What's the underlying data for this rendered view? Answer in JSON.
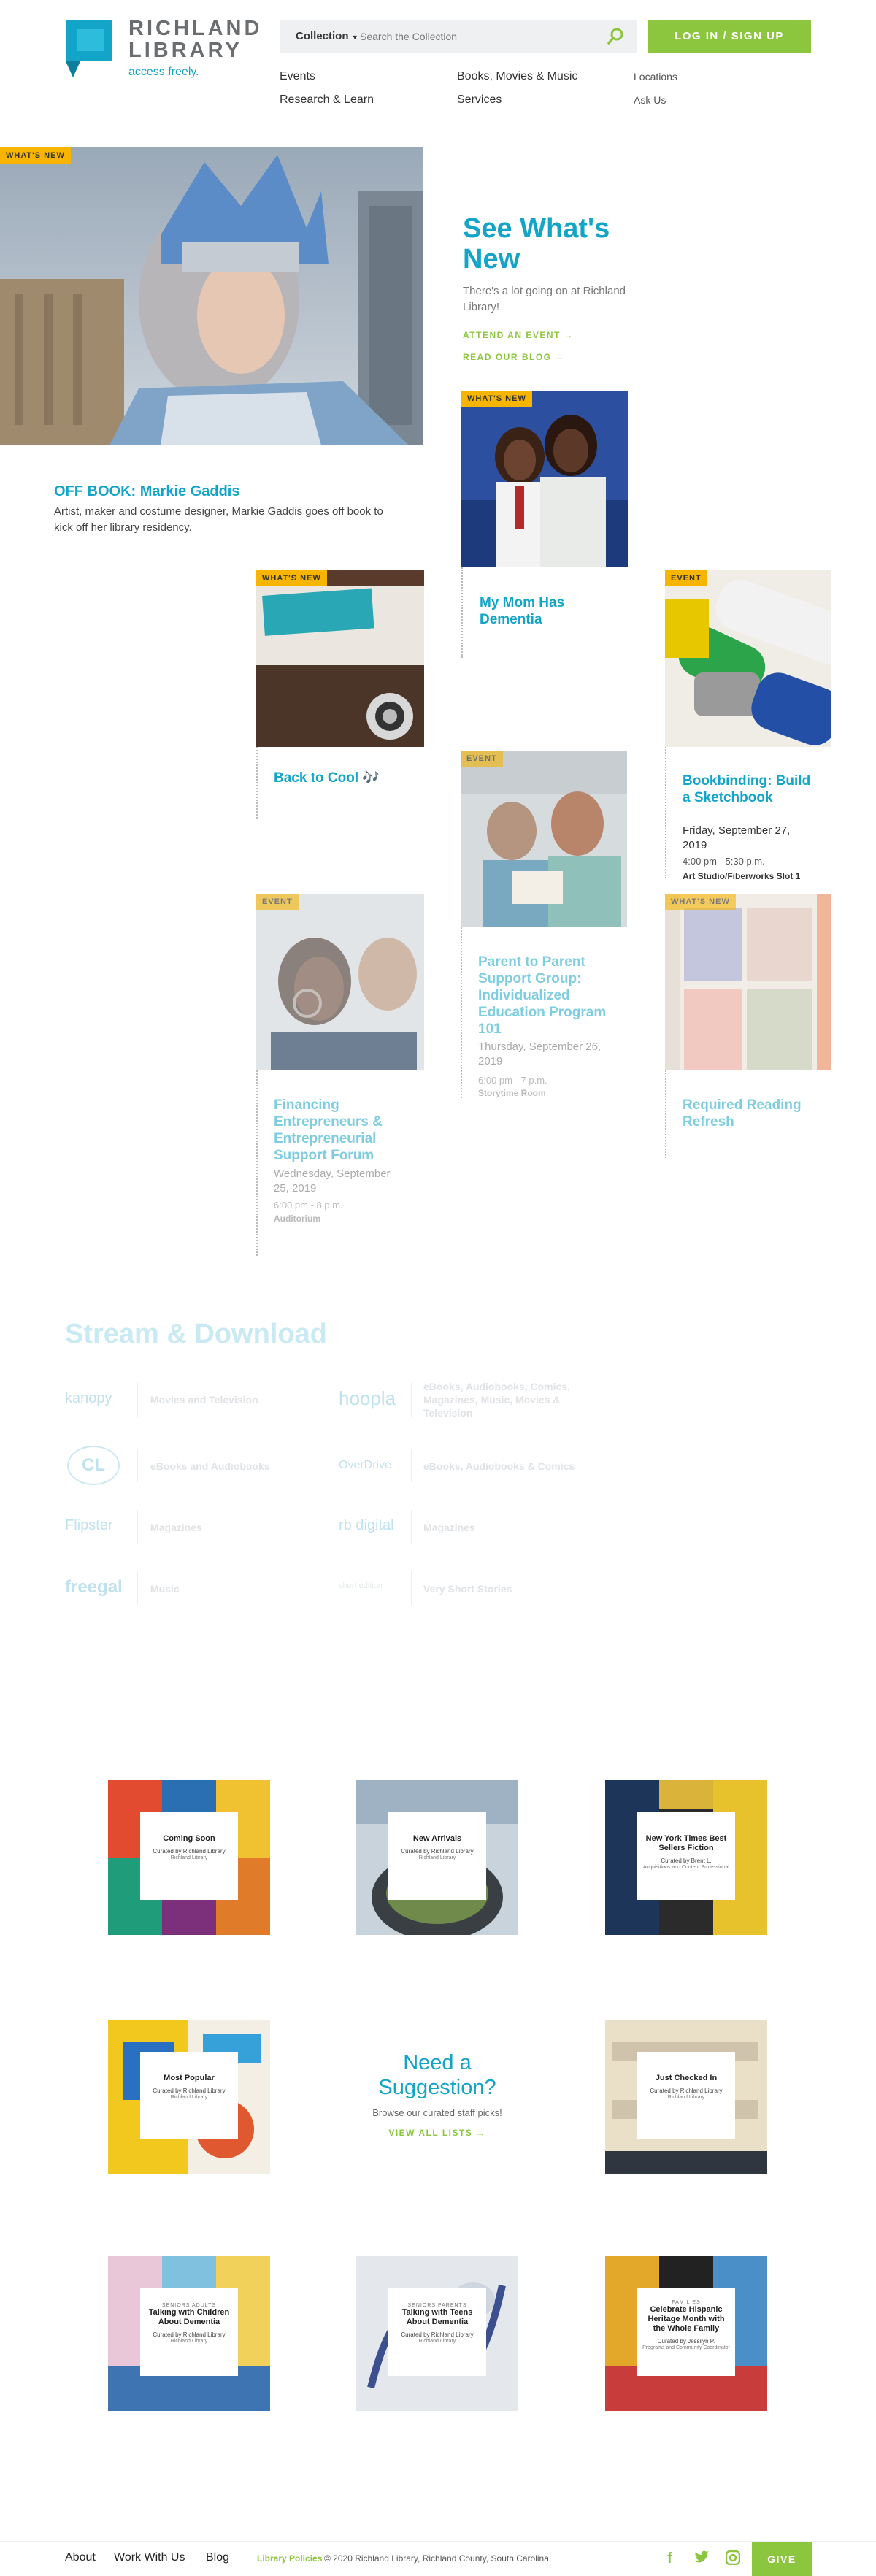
{
  "header": {
    "logo_title_line1": "RICHLAND",
    "logo_title_line2": "LIBRARY",
    "logo_tagline": "access freely.",
    "search_scope": "Collection",
    "search_placeholder": "Search the Collection",
    "login_label": "LOG IN / SIGN UP",
    "nav": [
      "Events",
      "Research & Learn",
      "Books, Movies & Music",
      "Services"
    ],
    "nav_small": [
      "Locations",
      "Ask Us"
    ]
  },
  "feature": {
    "badge": "WHAT'S NEW",
    "title": "OFF BOOK: Markie Gaddis",
    "desc": "Artist, maker and costume designer, Markie Gaddis goes off book to kick off her library residency."
  },
  "intro": {
    "title": "See What's New",
    "desc": "There's a lot going on at Richland Library!",
    "link1": "ATTEND AN EVENT →",
    "link2": "READ OUR BLOG →"
  },
  "cards": [
    {
      "badge": "WHAT'S NEW",
      "title": "My Mom Has Dementia"
    },
    {
      "badge": "WHAT'S NEW",
      "title": "Back to Cool 🎶"
    },
    {
      "badge": "EVENT",
      "title": "Bookbinding: Build a Sketchbook",
      "date": "Friday, September 27, 2019",
      "time": "4:00 pm - 5:30 p.m.",
      "location": "Art Studio/Fiberworks Slot 1"
    },
    {
      "badge": "EVENT",
      "title": "Parent to Parent Support Group: Individualized Education Program 101",
      "date": "Thursday, September 26, 2019",
      "time": "6:00 pm - 7 p.m.",
      "location": "Storytime Room"
    },
    {
      "badge": "EVENT",
      "title": "Financing Entrepreneurs & Entrepreneurial Support Forum",
      "date": "Wednesday, September 25, 2019",
      "time": "6:00 pm - 8 p.m.",
      "location": "Auditorium"
    },
    {
      "badge": "WHAT'S NEW",
      "title": "Required Reading Refresh"
    }
  ],
  "stream": {
    "title": "Stream & Download",
    "items": [
      {
        "logo": "kanopy",
        "desc": "Movies and Television"
      },
      {
        "logo": "hoopla",
        "desc": "eBooks, Audiobooks, Comics, Magazines, Music, Movies & Television"
      },
      {
        "logo": "CL",
        "desc": "eBooks and Audiobooks"
      },
      {
        "logo": "OverDrive",
        "desc": "eBooks, Audiobooks & Comics"
      },
      {
        "logo": "Flipster",
        "desc": "Magazines"
      },
      {
        "logo": "rb digital",
        "desc": "Magazines"
      },
      {
        "logo": "freegal",
        "desc": "Music"
      },
      {
        "logo": "short edition",
        "desc": "Very Short Stories"
      }
    ]
  },
  "lists": [
    {
      "kicker": "",
      "title": "Coming Soon",
      "curator": "Curated by Richland Library",
      "sub": "Richland Library"
    },
    {
      "kicker": "",
      "title": "New Arrivals",
      "curator": "Curated by Richland Library",
      "sub": "Richland Library"
    },
    {
      "kicker": "",
      "title": "New York Times Best Sellers Fiction",
      "curator": "Curated by Brent L.",
      "sub": "Acquisitions and Content Professional"
    },
    {
      "kicker": "",
      "title": "Most Popular",
      "curator": "Curated by Richland Library",
      "sub": "Richland Library"
    },
    {
      "kicker": "",
      "title": "Just Checked In",
      "curator": "Curated by Richland Library",
      "sub": "Richland Library"
    },
    {
      "kicker": "SENIORS ADULTS",
      "title": "Talking with Children About Dementia",
      "curator": "Curated by Richland Library",
      "sub": "Richland Library"
    },
    {
      "kicker": "SENIORS PARENTS",
      "title": "Talking with Teens About Dementia",
      "curator": "Curated by Richland Library",
      "sub": "Richland Library"
    },
    {
      "kicker": "FAMILIES",
      "title": "Celebrate Hispanic Heritage Month with the Whole Family",
      "curator": "Curated by Jessilyn P.",
      "sub": "Programs and Community Coordinator"
    }
  ],
  "suggestion": {
    "title": "Need a Suggestion?",
    "desc": "Browse our curated staff picks!",
    "link": "VIEW ALL LISTS →"
  },
  "footer": {
    "links": [
      "About",
      "Work With Us",
      "Blog"
    ],
    "policies": "Library Policies",
    "copyright": "© 2020 Richland Library, Richland County, South Carolina",
    "give": "GIVE"
  },
  "colors": {
    "accent": "#13a5c7",
    "green": "#8cc63f",
    "badge": "#f7b500"
  }
}
